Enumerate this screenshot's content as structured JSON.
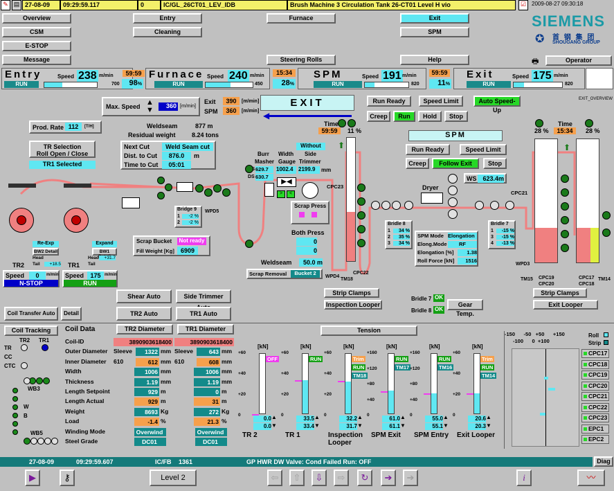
{
  "topbar": {
    "date": "27-08-09",
    "time": "09:29:59.117",
    "code": "0",
    "tag": "IC/GL_26CT01_LEV_IDB",
    "message": "Brush Machine 3 Circulation Tank 26-CT01 Level H vio",
    "clock": "2009-08-27 09:30:18"
  },
  "nav": {
    "row1": [
      "Overview",
      "Entry",
      "Furnace",
      "Exit",
      "SPM"
    ],
    "row2": [
      "CSM",
      "Cleaning",
      "",
      "SPM",
      ""
    ],
    "row3": [
      "E-STOP",
      "",
      "",
      "",
      ""
    ],
    "row4": [
      "Message",
      "",
      "Steering Rolls",
      "Help"
    ],
    "operator": "Operator"
  },
  "brand": {
    "name": "SIEMENS",
    "cn": "首 钢 集 团",
    "en": "SHOUGANG GROUP"
  },
  "sections": [
    {
      "title": "Entry",
      "speed": "238",
      "unit": "m/min",
      "timer": "59:59",
      "pct": "98",
      "pctunit": "%",
      "state": "RUN",
      "max": "700"
    },
    {
      "title": "Furnace",
      "speed": "240",
      "unit": "m/min",
      "timer": "15:34",
      "pct": "28",
      "pctunit": "%",
      "state": "RUN",
      "max": "450"
    },
    {
      "title": "SPM",
      "speed": "191",
      "unit": "m/min",
      "timer": "59:59",
      "pct": "11",
      "pctunit": "%",
      "state": "RUN",
      "max": "820"
    },
    {
      "title": "Exit",
      "speed": "175",
      "unit": "m/min",
      "timer": "",
      "pct": "",
      "pctunit": "",
      "state": "RUN",
      "max": "820"
    }
  ],
  "exit_header": {
    "maxspeed_label": "Max. Speed",
    "maxspeed": "360",
    "maxspeed_unit": "[m/min]",
    "exit_label": "Exit",
    "exit_val": "390",
    "spm_label": "SPM",
    "spm_val": "360",
    "unit": "[m/min]",
    "title": "EXIT",
    "overview": "EXIT_OVERVIEW"
  },
  "left_panel": {
    "prod_rate_label": "Prod. Rate",
    "prod_rate": "112",
    "prod_rate_unit": "[T/H]",
    "tr_sel": "TR Selection",
    "tr_roll": "Roll Open / Close",
    "tr1_sel": "TR1 Selected"
  },
  "weld": {
    "weldseam_label": "Weldseam",
    "weldseam": "877 m",
    "residual_label": "Residual weight",
    "residual": "8.24 tons",
    "nextcut_label": "Next Cut",
    "nextcut": "Weld Seam cut",
    "dist_label": "Dist. to Cut",
    "dist": "876.0",
    "dist_unit": "m",
    "time_label": "Time to Cut",
    "time": "05:01"
  },
  "equip": {
    "burr": "Burr",
    "masher": "Masher",
    "width": "Width",
    "gauge": "Gauge",
    "without": "Without",
    "side": "Side",
    "trimmer": "Trimmer",
    "os": "OS",
    "os_val": "629.7",
    "ds": "DS",
    "ds_val": "630.7",
    "gauge_val": "1002.4",
    "trim_val": "2199.9",
    "trim_unit": "mm",
    "cpc23": "CPC23",
    "scrap_press": "Scrap Press",
    "both_press": "Both Press",
    "bp1": "0",
    "bp2": "0",
    "bp3": "0",
    "weldseam2_label": "Weldseam",
    "weldseam2": "50.0 m",
    "scrap_removal": "Scrap Removal",
    "bucket2": "Bucket 2",
    "wpd4": "WPD4",
    "tm18": "TM18",
    "cpc22": "CPC22",
    "wpd5": "WPD5",
    "bridge9": "Bridge 9",
    "b9_1": "-2 %",
    "b9_2": "-2 %"
  },
  "scrap": {
    "bucket": "Scrap Bucket",
    "not_ready": "Not ready",
    "fill_label": "Fill Weight [Kg]",
    "fill": "6909"
  },
  "tr_units": {
    "tr2": "TR2",
    "tr1": "TR1",
    "reexp": "Re-Exp",
    "expand": "Expand",
    "bw2": "BW2 Detail",
    "bw1": "BW1 Detail",
    "head": "Head",
    "tail": "Tail",
    "tail_val": "+18.5",
    "tail2_val": "+31.7",
    "speed_label": "Speed",
    "tr2_speed": "0",
    "tr1_speed": "175",
    "sp_unit": "m/min",
    "tr2_state": "N-STOP",
    "tr1_state": "RUN"
  },
  "exit_ctrl": {
    "runready": "Run Ready",
    "speedlimit": "Speed Limit",
    "autospeed": "Auto Speed-Up",
    "creep": "Creep",
    "run": "Run",
    "hold": "Hold",
    "stop": "Stop",
    "time_label": "Time",
    "time": "59:59",
    "pct": "11",
    "unit": "%"
  },
  "spm": {
    "title": "SPM",
    "runready": "Run Ready",
    "speedlimit": "Speed Limit",
    "creep": "Creep",
    "follow": "Follow Exit",
    "stop": "Stop",
    "dryer": "Dryer",
    "ws_label": "WS",
    "ws": "623.4m",
    "cpc21": "CPC21",
    "mode_label": "SPM Mode",
    "mode": "Elongation",
    "elong_label": "Elong.Mode",
    "elong": "RF",
    "elongpct_label": "Elongation [%]",
    "elongpct": "1.38",
    "rollforce_label": "Roll Force [kN]",
    "rollforce": "1516"
  },
  "bridles": {
    "b8": "Bridle 8",
    "b8v": [
      "34 %",
      "35 %",
      "34 %"
    ],
    "b7": "Bridle 7",
    "b7v": [
      "-15 %",
      "-15 %",
      "-13 %"
    ],
    "b7_ok_label": "Bridle 7",
    "b8_ok_label": "Bridle 8",
    "ok": "OK",
    "gear": "Gear Temp."
  },
  "right_loop": {
    "time_label": "Time",
    "time": "15:34",
    "pct_l": "28",
    "pct_r": "28",
    "unit": "%",
    "wpd3": "WPD3",
    "tm15": "TM15",
    "cpc19": "CPC19",
    "cpc20": "CPC20",
    "cpc17": "CPC17",
    "cpc18": "CPC18",
    "tm14": "TM14",
    "strip_clamps": "Strip Clamps",
    "exit_looper": "Exit Looper"
  },
  "mid_btns": {
    "shear": "Shear Auto",
    "side_trim": "Side Trimmer Auto",
    "tr2auto": "TR2 Auto",
    "tr1auto": "TR1 Auto",
    "coil_transfer": "Coil Transfer Auto",
    "detail": "Detail",
    "strip_clamps": "Strip Clamps",
    "insp_looper": "Inspection Looper"
  },
  "coil_tracking": {
    "title": "Coil Tracking",
    "tr2": "TR2",
    "tr1": "TR1",
    "tr": "TR",
    "cc": "CC",
    "ctc": "CTC",
    "wb3": "WB3",
    "w": "W",
    "b": "B",
    "wb5": "WB5"
  },
  "coil_data": {
    "title": "Coil Data",
    "tr2diam": "TR2 Diameter",
    "tr1diam": "TR1 Diameter",
    "rows": [
      {
        "label": "Coil-ID",
        "v1": "3890903618400",
        "v2": "3890903618400",
        "u": ""
      },
      {
        "label": "Outer Diameter",
        "p1": "Sleeve",
        "v1": "1322",
        "v2": "643",
        "p2": "Sleeve",
        "u": "mm"
      },
      {
        "label": "Inner Diameter",
        "p1": "610",
        "v1": "612",
        "v2": "608",
        "p2": "610",
        "u": "mm"
      },
      {
        "label": "Width",
        "v1": "1006",
        "v2": "1006",
        "u": "mm"
      },
      {
        "label": "Thickness",
        "v1": "1.19",
        "v2": "1.19",
        "u": "mm"
      },
      {
        "label": "Length Setpoint",
        "v1": "929",
        "v2": "0",
        "u": "m"
      },
      {
        "label": "Length Actual",
        "v1": "929",
        "v2": "31",
        "u": "m"
      },
      {
        "label": "Weight",
        "v1": "8693",
        "v2": "272",
        "u": "Kg"
      },
      {
        "label": "Load",
        "v1": "-1.4",
        "v2": "21.3",
        "u": "%"
      },
      {
        "label": "Winding Mode",
        "v1": "Overwind",
        "v2": "Overwind",
        "u": ""
      },
      {
        "label": "Steel Grade",
        "v1": "DC01",
        "v2": "DC01",
        "u": ""
      }
    ]
  },
  "tension": {
    "title": "Tension",
    "unit": "[kN]",
    "panels": [
      {
        "name": "TR 2",
        "badge": "OFF",
        "act": "0.0",
        "set": "0.0",
        "scale": [
          "+60",
          "+40",
          "+20",
          "0"
        ],
        "fill": 0.0
      },
      {
        "name": "TR 1",
        "badge": "RUN",
        "act": "33.5",
        "set": "33.4",
        "scale": [
          "+60",
          "+40",
          "+20",
          "0"
        ],
        "fill": 0.56
      },
      {
        "name": "Inspection Looper",
        "badge": "Trim",
        "badge2": "RUN",
        "badge3": "TM18",
        "act": "32.2",
        "set": "31.7",
        "scale": [
          "+60",
          "+40",
          "+20",
          "0"
        ],
        "fill": 0.54
      },
      {
        "name": "SPM Exit",
        "badge": "RUN",
        "badge2": "TM17",
        "act": "61.0",
        "set": "61.1",
        "scale": [
          "+160",
          "+120",
          "+80",
          "+40",
          "0"
        ],
        "fill": 0.38
      },
      {
        "name": "SPM Entry",
        "badge": "RUN",
        "badge2": "TM16",
        "act": "55.0",
        "set": "55.1",
        "scale": [
          "+160",
          "+120",
          "+80",
          "+40",
          "0"
        ],
        "fill": 0.34
      },
      {
        "name": "Exit Looper",
        "badge": "Trim",
        "badge2": "RUN",
        "badge3": "TM14",
        "act": "20.6",
        "set": "20.3",
        "scale": [
          "+60",
          "+40",
          "+20",
          "0"
        ],
        "fill": 0.34
      }
    ]
  },
  "steering": {
    "scale_top": [
      "-150",
      "-50",
      "+50",
      "+150"
    ],
    "scale_sub": [
      "-100",
      "0",
      "+100"
    ],
    "roll": "Roll",
    "strip": "Strip",
    "cpcs": [
      "CPC17",
      "CPC18",
      "CPC19",
      "CPC20",
      "CPC21",
      "CPC22",
      "CPC23",
      "EPC1",
      "EPC2"
    ]
  },
  "status": {
    "date": "27-08-09",
    "time": "09:29:59.607",
    "code": "IC/FB",
    "num": "1361",
    "msg": "GP HWR  DW Valve: Cond Failed Run: OFF",
    "diag": "Diag"
  },
  "bottom": {
    "level": "Level 2"
  },
  "colors": {
    "bg": "#c0c0c0",
    "accent": "#5fe7f2",
    "alarm": "#f3f06a",
    "timer": "#f6a04c",
    "strip": "#f08080",
    "roll": "#1a7a1a"
  }
}
